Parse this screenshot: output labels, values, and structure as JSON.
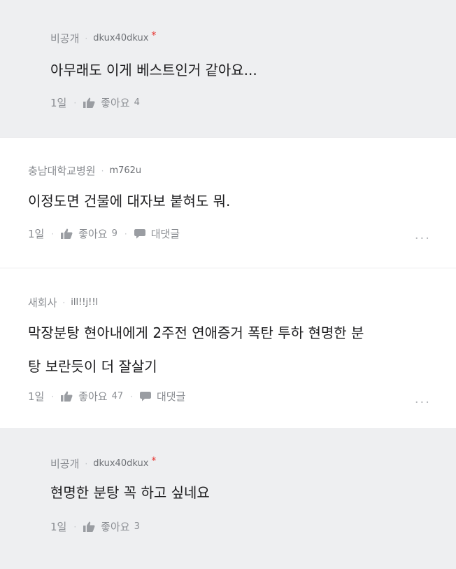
{
  "comments": [
    {
      "author": "비공개",
      "nickname": "dkux40dkux",
      "star": "*",
      "text": "아무래도 이게 베스트인거 같아요...",
      "time": "1일",
      "like_label": "좋아요",
      "like_count": "4"
    },
    {
      "author": "충남대학교병원",
      "nickname": "m762u",
      "text": "이정도면 건물에 대자보 붙혀도 뭐.",
      "time": "1일",
      "like_label": "좋아요",
      "like_count": "9",
      "reply_label": "대댓글",
      "more": "..."
    },
    {
      "author": "새회사",
      "nickname": "ill!!j!!l",
      "text_line1": "막장분탕 현아내에게 2주전 연애증거 폭탄 투하  현명한 분",
      "text_line2": "탕 보란듯이 더 잘살기",
      "time": "1일",
      "like_label": "좋아요",
      "like_count": "47",
      "reply_label": "대댓글",
      "more": "..."
    },
    {
      "author": "비공개",
      "nickname": "dkux40dkux",
      "star": "*",
      "text": "현명한 분탕 꼭 하고 싶네요",
      "time": "1일",
      "like_label": "좋아요",
      "like_count": "3"
    }
  ],
  "icons": {
    "like": "thumbs-up-icon",
    "reply": "speech-bubble-icon",
    "more": "more-icon"
  },
  "colors": {
    "reply_bg": "#eeeff1",
    "star": "#e5322e",
    "meta_text": "#8a8d92"
  }
}
